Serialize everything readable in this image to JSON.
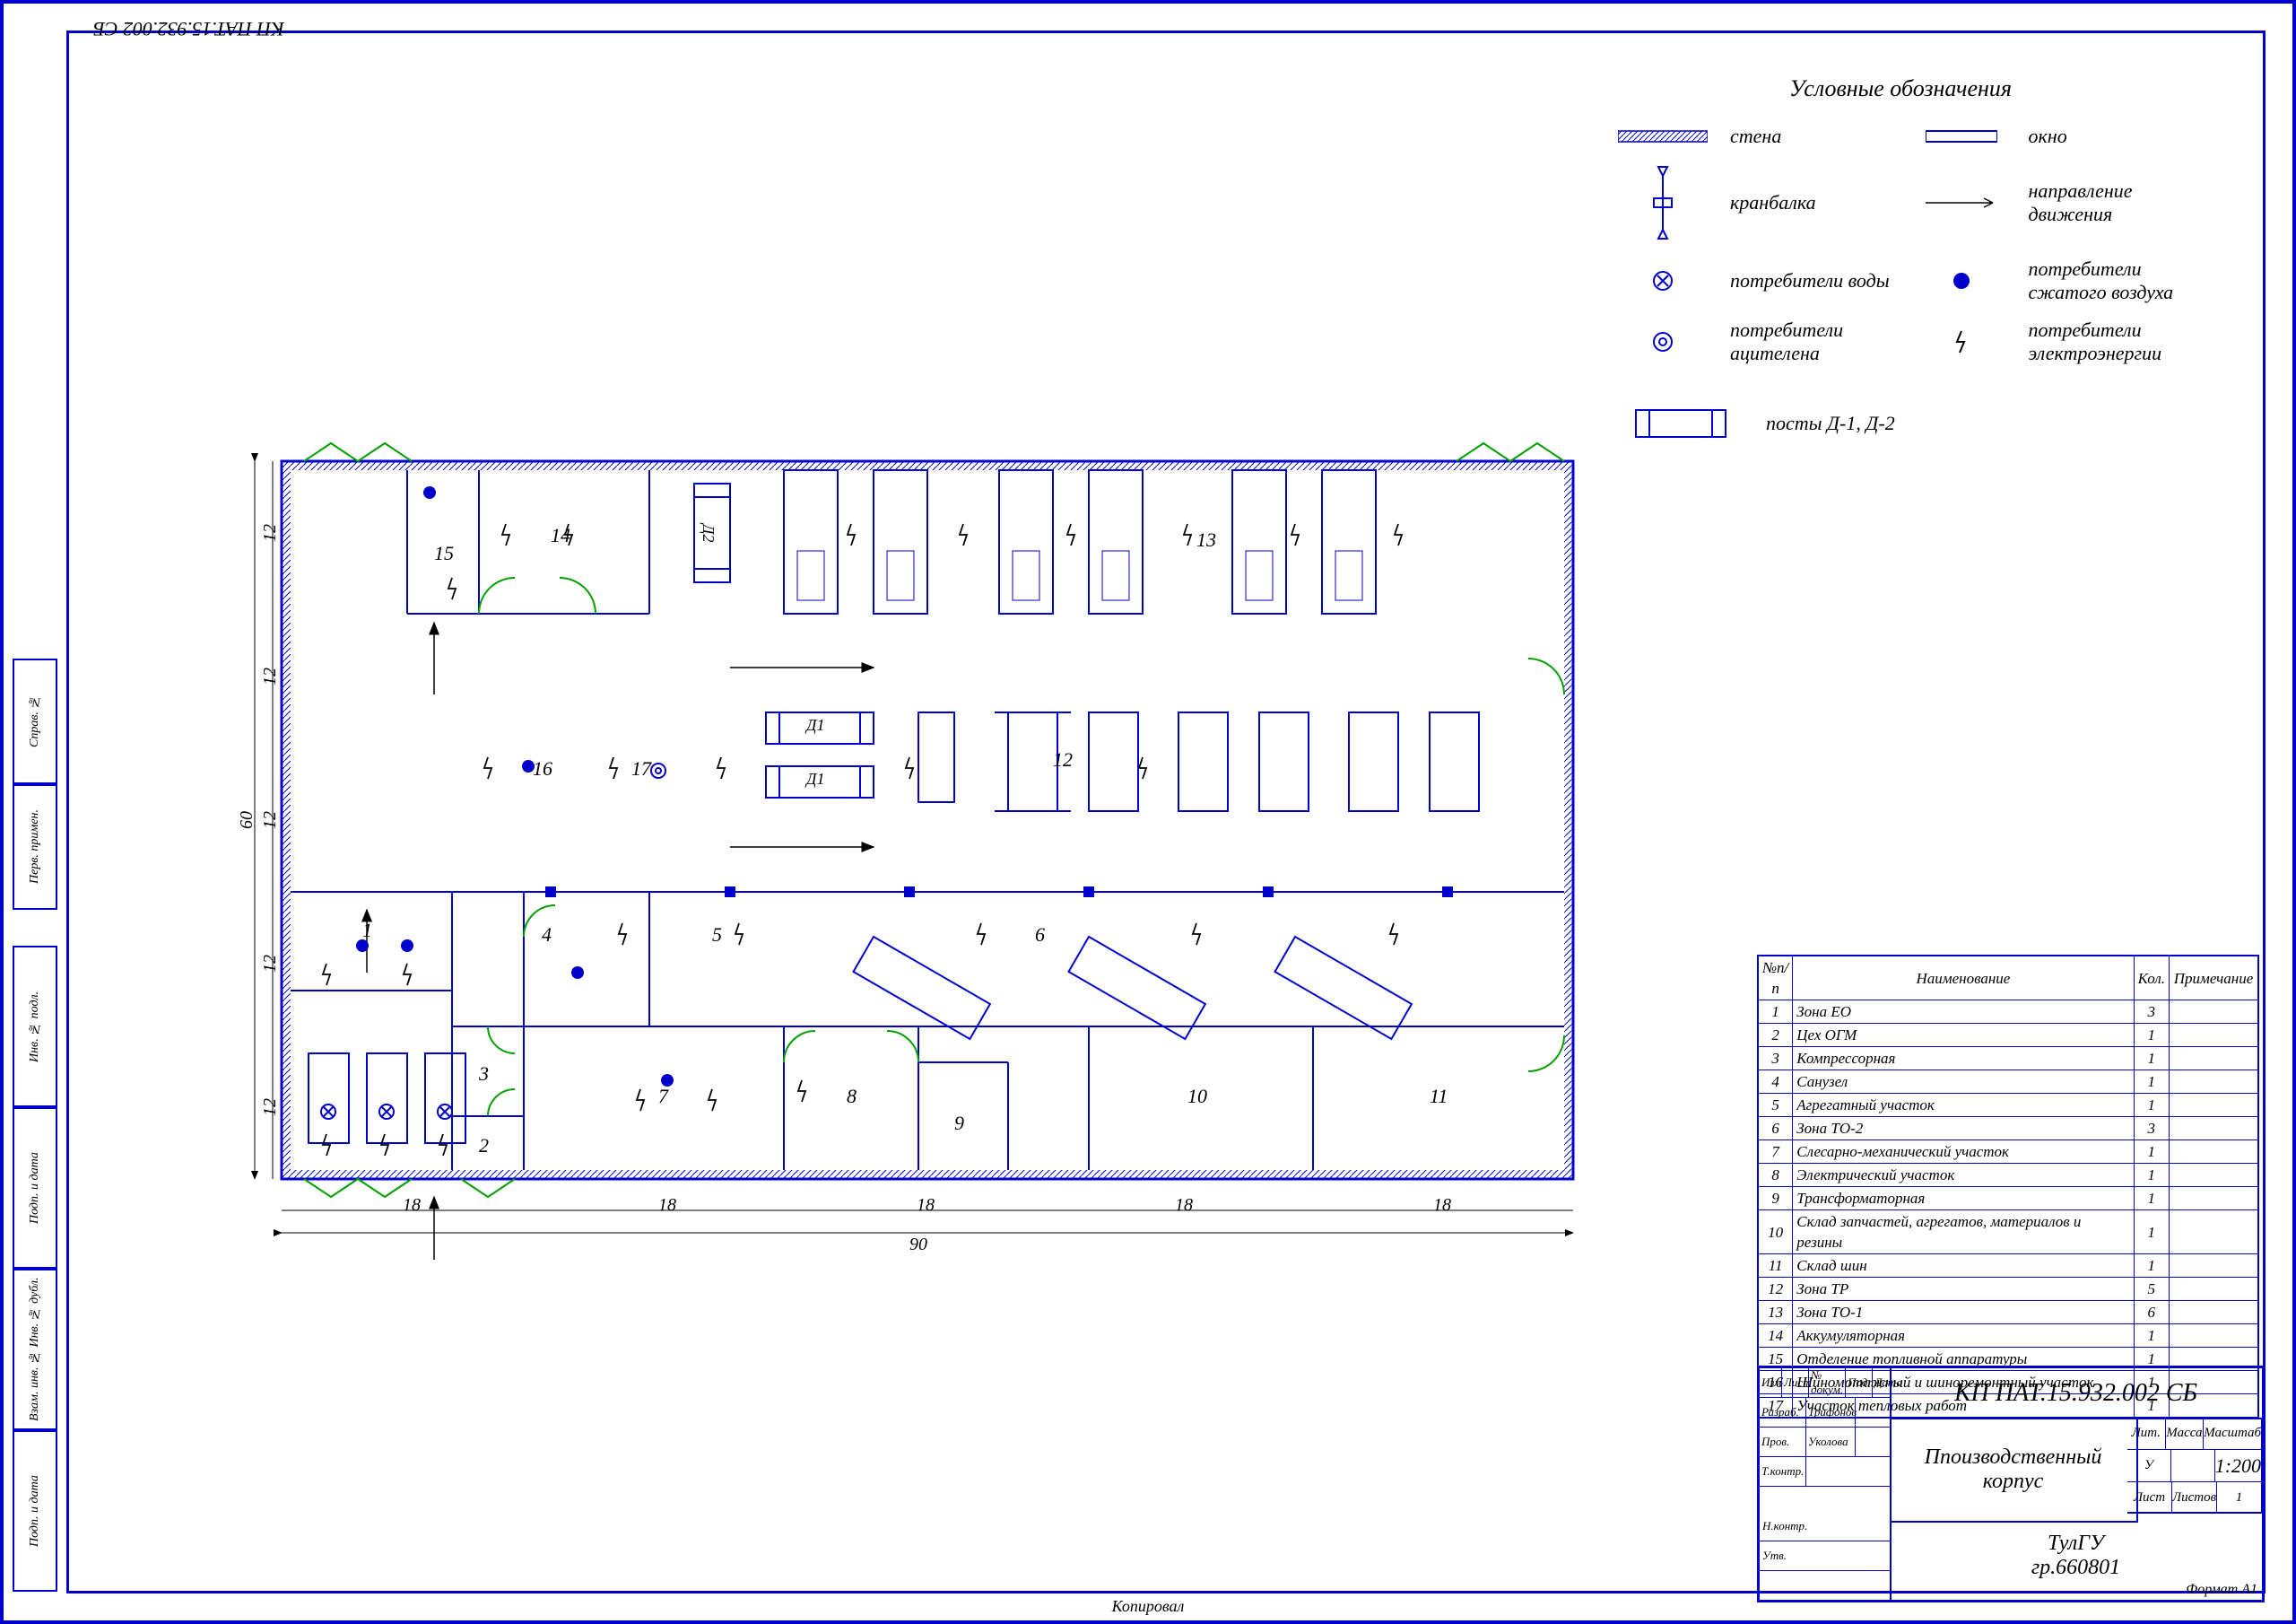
{
  "doc_number_rot": "КП ПАТ.15.932.002 СБ",
  "legend": {
    "title": "Условные обозначения",
    "items": [
      {
        "sym": "wall",
        "label": "стена"
      },
      {
        "sym": "window",
        "label": "окно"
      },
      {
        "sym": "crane",
        "label": "кранбалка"
      },
      {
        "sym": "arrow",
        "label": "направление движения"
      },
      {
        "sym": "water",
        "label": "потребители воды"
      },
      {
        "sym": "air",
        "label": "потребители сжатого воздуха"
      },
      {
        "sym": "acet",
        "label": "потребители ацителена"
      },
      {
        "sym": "elec",
        "label": "потребители электроэнергии"
      },
      {
        "sym": "post",
        "label": "посты Д-1, Д-2"
      }
    ]
  },
  "dimensions": {
    "overall_w": "90",
    "overall_h": "60",
    "row_v": [
      "12",
      "12",
      "12",
      "12",
      "12"
    ],
    "row_h": [
      "18",
      "18",
      "18",
      "18",
      "18"
    ]
  },
  "rooms": [
    {
      "n": "1"
    },
    {
      "n": "2"
    },
    {
      "n": "3"
    },
    {
      "n": "4"
    },
    {
      "n": "5"
    },
    {
      "n": "6"
    },
    {
      "n": "7"
    },
    {
      "n": "8"
    },
    {
      "n": "9"
    },
    {
      "n": "10"
    },
    {
      "n": "11"
    },
    {
      "n": "12"
    },
    {
      "n": "13"
    },
    {
      "n": "14"
    },
    {
      "n": "15"
    },
    {
      "n": "16"
    },
    {
      "n": "17"
    }
  ],
  "post_labels": {
    "d1": "Д1",
    "d2": "Д2"
  },
  "table": {
    "headers": [
      "№п/п",
      "Наименование",
      "Кол.",
      "Примечание"
    ],
    "rows": [
      [
        "1",
        "Зона ЕО",
        "3",
        ""
      ],
      [
        "2",
        "Цех ОГМ",
        "1",
        ""
      ],
      [
        "3",
        "Компрессорная",
        "1",
        ""
      ],
      [
        "4",
        "Санузел",
        "1",
        ""
      ],
      [
        "5",
        "Агрегатный участок",
        "1",
        ""
      ],
      [
        "6",
        "Зона ТО-2",
        "3",
        ""
      ],
      [
        "7",
        "Слесарно-механический участок",
        "1",
        ""
      ],
      [
        "8",
        "Электрический участок",
        "1",
        ""
      ],
      [
        "9",
        "Трансформаторная",
        "1",
        ""
      ],
      [
        "10",
        "Склад запчастей, агрегатов, материалов и резины",
        "1",
        ""
      ],
      [
        "11",
        "Склад шин",
        "1",
        ""
      ],
      [
        "12",
        "Зона ТР",
        "5",
        ""
      ],
      [
        "13",
        "Зона ТО-1",
        "6",
        ""
      ],
      [
        "14",
        "Аккумуляторная",
        "1",
        ""
      ],
      [
        "15",
        "Отделение топливной аппаратуры",
        "1",
        ""
      ],
      [
        "16",
        "Шиномотажный и шиноремонтный участок",
        "1",
        ""
      ],
      [
        "17",
        "Участок тепловых работ",
        "1",
        ""
      ]
    ]
  },
  "titleblock": {
    "docnum": "КП ПАТ.15.932.002 СБ",
    "title": "Ппоизводственный корпус",
    "rows": [
      [
        "Изм",
        "Лист",
        "№ докум.",
        "Подп.",
        "Дата"
      ],
      [
        "Разраб.",
        "Трифонов",
        "",
        "",
        ""
      ],
      [
        "Пров.",
        "Уколова",
        "",
        "",
        ""
      ],
      [
        "Т.контр.",
        "",
        "",
        "",
        ""
      ]
    ],
    "bottom_rows": [
      "Н.контр.",
      "Утв."
    ],
    "right": {
      "h1": [
        "Лит.",
        "Масса",
        "Масштаб"
      ],
      "scale": "1:200",
      "u": "У",
      "sheet": [
        "Лист",
        "Листов",
        "1"
      ]
    },
    "org": "ТулГУ",
    "group": "гр.660801",
    "format": "Формат    А1"
  },
  "stamp_col": [
    "Инв. № подл.",
    "Подп. и дата",
    "Взам. инв. № Инв. № дубл.",
    "Подп. и дата",
    "Справ. №",
    "Перв. примен."
  ],
  "footer": "Копировал"
}
